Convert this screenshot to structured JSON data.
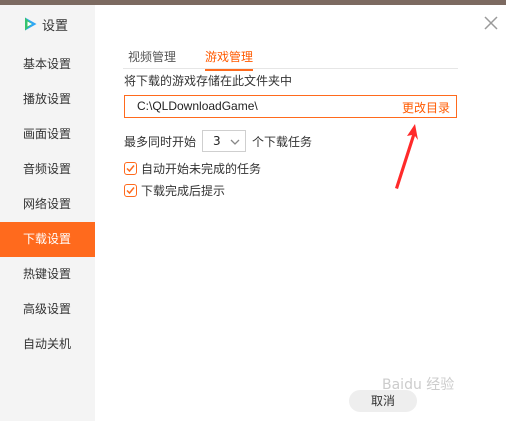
{
  "app": {
    "title": "设置",
    "logo_icon": "tencent-video-logo-icon"
  },
  "colors": {
    "accent": "#ff6a1d",
    "accent_text": "#ff5a00",
    "sidebar_bg": "#f4f4f4"
  },
  "sidebar": {
    "items": [
      {
        "label": "基本设置",
        "active": false
      },
      {
        "label": "播放设置",
        "active": false
      },
      {
        "label": "画面设置",
        "active": false
      },
      {
        "label": "音频设置",
        "active": false
      },
      {
        "label": "网络设置",
        "active": false
      },
      {
        "label": "下载设置",
        "active": true
      },
      {
        "label": "热键设置",
        "active": false
      },
      {
        "label": "高级设置",
        "active": false
      },
      {
        "label": "自动关机",
        "active": false
      }
    ]
  },
  "tabs": [
    {
      "label": "视频管理",
      "active": false
    },
    {
      "label": "游戏管理",
      "active": true
    }
  ],
  "content": {
    "description": "将下载的游戏存储在此文件夹中",
    "path_value": "C:\\QLDownloadGame\\",
    "change_dir_label": "更改目录",
    "max_tasks_prefix": "最多同时开始",
    "max_tasks_value": "3",
    "max_tasks_suffix": "个下载任务",
    "checkbox_auto_start": {
      "label": "自动开始未完成的任务",
      "checked": true
    },
    "checkbox_notify": {
      "label": "下载完成后提示",
      "checked": true
    }
  },
  "footer": {
    "cancel_label": "取消"
  },
  "watermark": "Baidu 经验",
  "icons": {
    "close": "close-icon",
    "dropdown": "chevron-down-icon",
    "check": "check-icon",
    "annotation": "red-arrow-icon"
  }
}
